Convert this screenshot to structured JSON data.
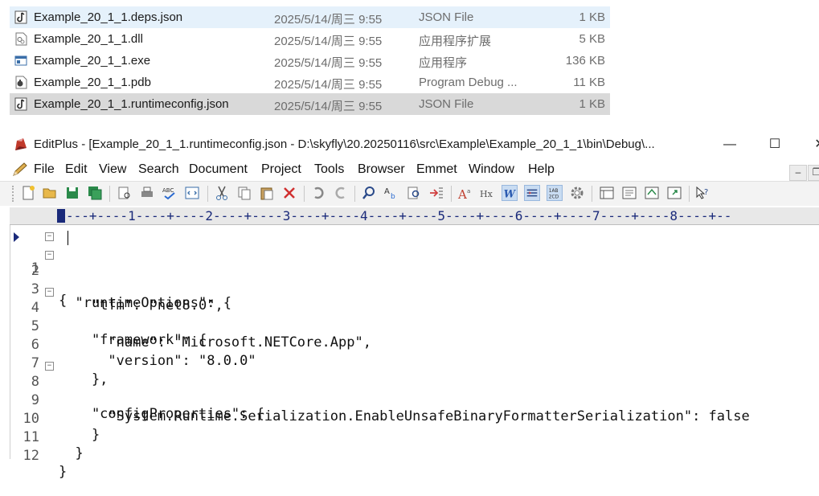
{
  "explorer": {
    "files": [
      {
        "name": "Example_20_1_1.deps.json",
        "date": "2025/5/14/周三 9:55",
        "type": "JSON File",
        "size": "1 KB",
        "icon": "json-file-icon",
        "state": "hover"
      },
      {
        "name": "Example_20_1_1.dll",
        "date": "2025/5/14/周三 9:55",
        "type": "应用程序扩展",
        "size": "5 KB",
        "icon": "dll-file-icon",
        "state": "normal"
      },
      {
        "name": "Example_20_1_1.exe",
        "date": "2025/5/14/周三 9:55",
        "type": "应用程序",
        "size": "136 KB",
        "icon": "exe-file-icon",
        "state": "normal"
      },
      {
        "name": "Example_20_1_1.pdb",
        "date": "2025/5/14/周三 9:55",
        "type": "Program Debug ...",
        "size": "11 KB",
        "icon": "pdb-file-icon",
        "state": "normal"
      },
      {
        "name": "Example_20_1_1.runtimeconfig.json",
        "date": "2025/5/14/周三 9:55",
        "type": "JSON File",
        "size": "1 KB",
        "icon": "json-file-icon",
        "state": "selected"
      }
    ]
  },
  "editor_window": {
    "title": "EditPlus - [Example_20_1_1.runtimeconfig.json - D:\\skyfly\\20.20250116\\src\\Example\\Example_20_1_1\\bin\\Debug\\...",
    "minimize": "—",
    "maximize": "☐",
    "close": "✕",
    "menus": [
      "File",
      "Edit",
      "View",
      "Search",
      "Document",
      "Project",
      "Tools",
      "Browser",
      "Emmet",
      "Window",
      "Help"
    ],
    "mdi_minimize": "–",
    "mdi_restore": "❐",
    "ruler": "---+----1----+----2----+----3----+----4----+----5----+----6----+----7----+----8----+--",
    "lines": [
      {
        "num": "1",
        "fold": "⊟",
        "text": "{"
      },
      {
        "num": "2",
        "fold": "⊟",
        "text": "  \"runtimeOptions\": {"
      },
      {
        "num": "3",
        "fold": "",
        "text": "    \"tfm\": \"net8.0\","
      },
      {
        "num": "4",
        "fold": "⊟",
        "text": "    \"framework\": {"
      },
      {
        "num": "5",
        "fold": "",
        "text": "      \"name\": \"Microsoft.NETCore.App\","
      },
      {
        "num": "6",
        "fold": "",
        "text": "      \"version\": \"8.0.0\""
      },
      {
        "num": "7",
        "fold": "",
        "text": "    },"
      },
      {
        "num": "8",
        "fold": "⊟",
        "text": "    \"configProperties\": {"
      },
      {
        "num": "9",
        "fold": "",
        "text": "      \"System.Runtime.Serialization.EnableUnsafeBinaryFormatterSerialization\": false"
      },
      {
        "num": "10",
        "fold": "",
        "text": "    }"
      },
      {
        "num": "11",
        "fold": "",
        "text": "  }"
      },
      {
        "num": "12",
        "fold": "",
        "text": "}"
      }
    ]
  },
  "colors": {
    "hover_row": "#e5f1fb",
    "selected_row": "#d9d9d9",
    "ruler_text": "#1a2a7a",
    "active_tool": "#c9dcf2"
  }
}
